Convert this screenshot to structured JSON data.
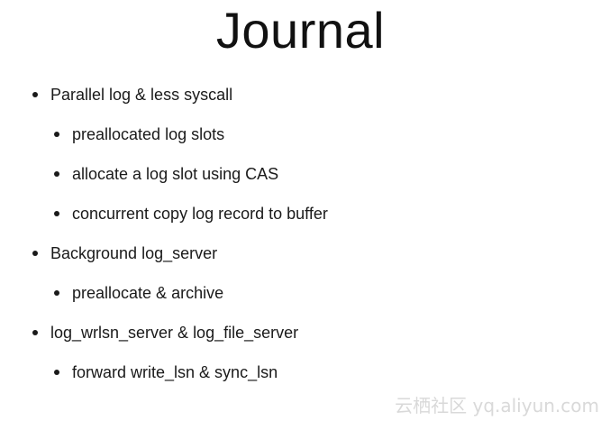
{
  "slide": {
    "title": "Journal",
    "bullets": [
      {
        "level": 1,
        "text": "Parallel log & less syscall"
      },
      {
        "level": 2,
        "text": "preallocated log slots"
      },
      {
        "level": 2,
        "text": "allocate a log slot using CAS"
      },
      {
        "level": 2,
        "text": "concurrent copy log record to buffer"
      },
      {
        "level": 1,
        "text": "Background log_server"
      },
      {
        "level": 2,
        "text": "preallocate & archive"
      },
      {
        "level": 1,
        "text": "log_wrlsn_server & log_file_server"
      },
      {
        "level": 2,
        "text": "forward write_lsn & sync_lsn"
      }
    ]
  },
  "watermark": {
    "text": "云栖社区 yq.aliyun.com"
  },
  "colors": {
    "text": "#1a1a1a",
    "background": "#ffffff",
    "watermark": "#d9d9d9"
  }
}
